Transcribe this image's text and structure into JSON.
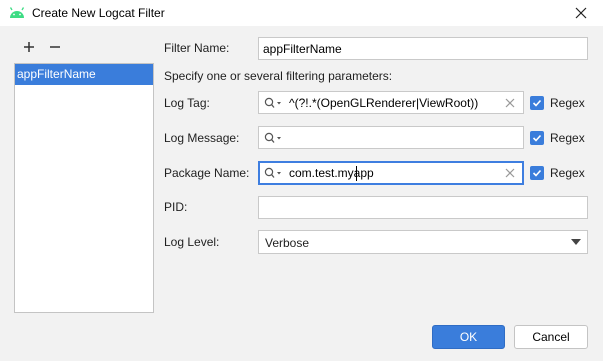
{
  "window": {
    "title": "Create New Logcat Filter",
    "close_icon": "close-icon",
    "app_icon": "android-icon"
  },
  "toolbar": {
    "add_icon": "plus-icon",
    "remove_icon": "minus-icon"
  },
  "filters": {
    "items": [
      "appFilterName"
    ],
    "selected_index": 0
  },
  "form": {
    "filter_name_label": "Filter Name:",
    "filter_name_value": "appFilterName",
    "instructions": "Specify one or several filtering parameters:",
    "log_tag_label": "Log Tag:",
    "log_tag_value": "^(?!.*(OpenGLRenderer|ViewRoot))",
    "log_tag_regex": true,
    "log_message_label": "Log Message:",
    "log_message_value": "",
    "log_message_regex": true,
    "package_name_label": "Package Name:",
    "package_name_value": "com.test.myapp",
    "package_name_regex": true,
    "regex_label": "Regex",
    "pid_label": "PID:",
    "pid_value": "",
    "log_level_label": "Log Level:",
    "log_level_value": "Verbose"
  },
  "buttons": {
    "ok": "OK",
    "cancel": "Cancel"
  },
  "colors": {
    "accent": "#3a7ddb",
    "focus_border": "#3e7ee0",
    "background": "#f2f2f2"
  }
}
